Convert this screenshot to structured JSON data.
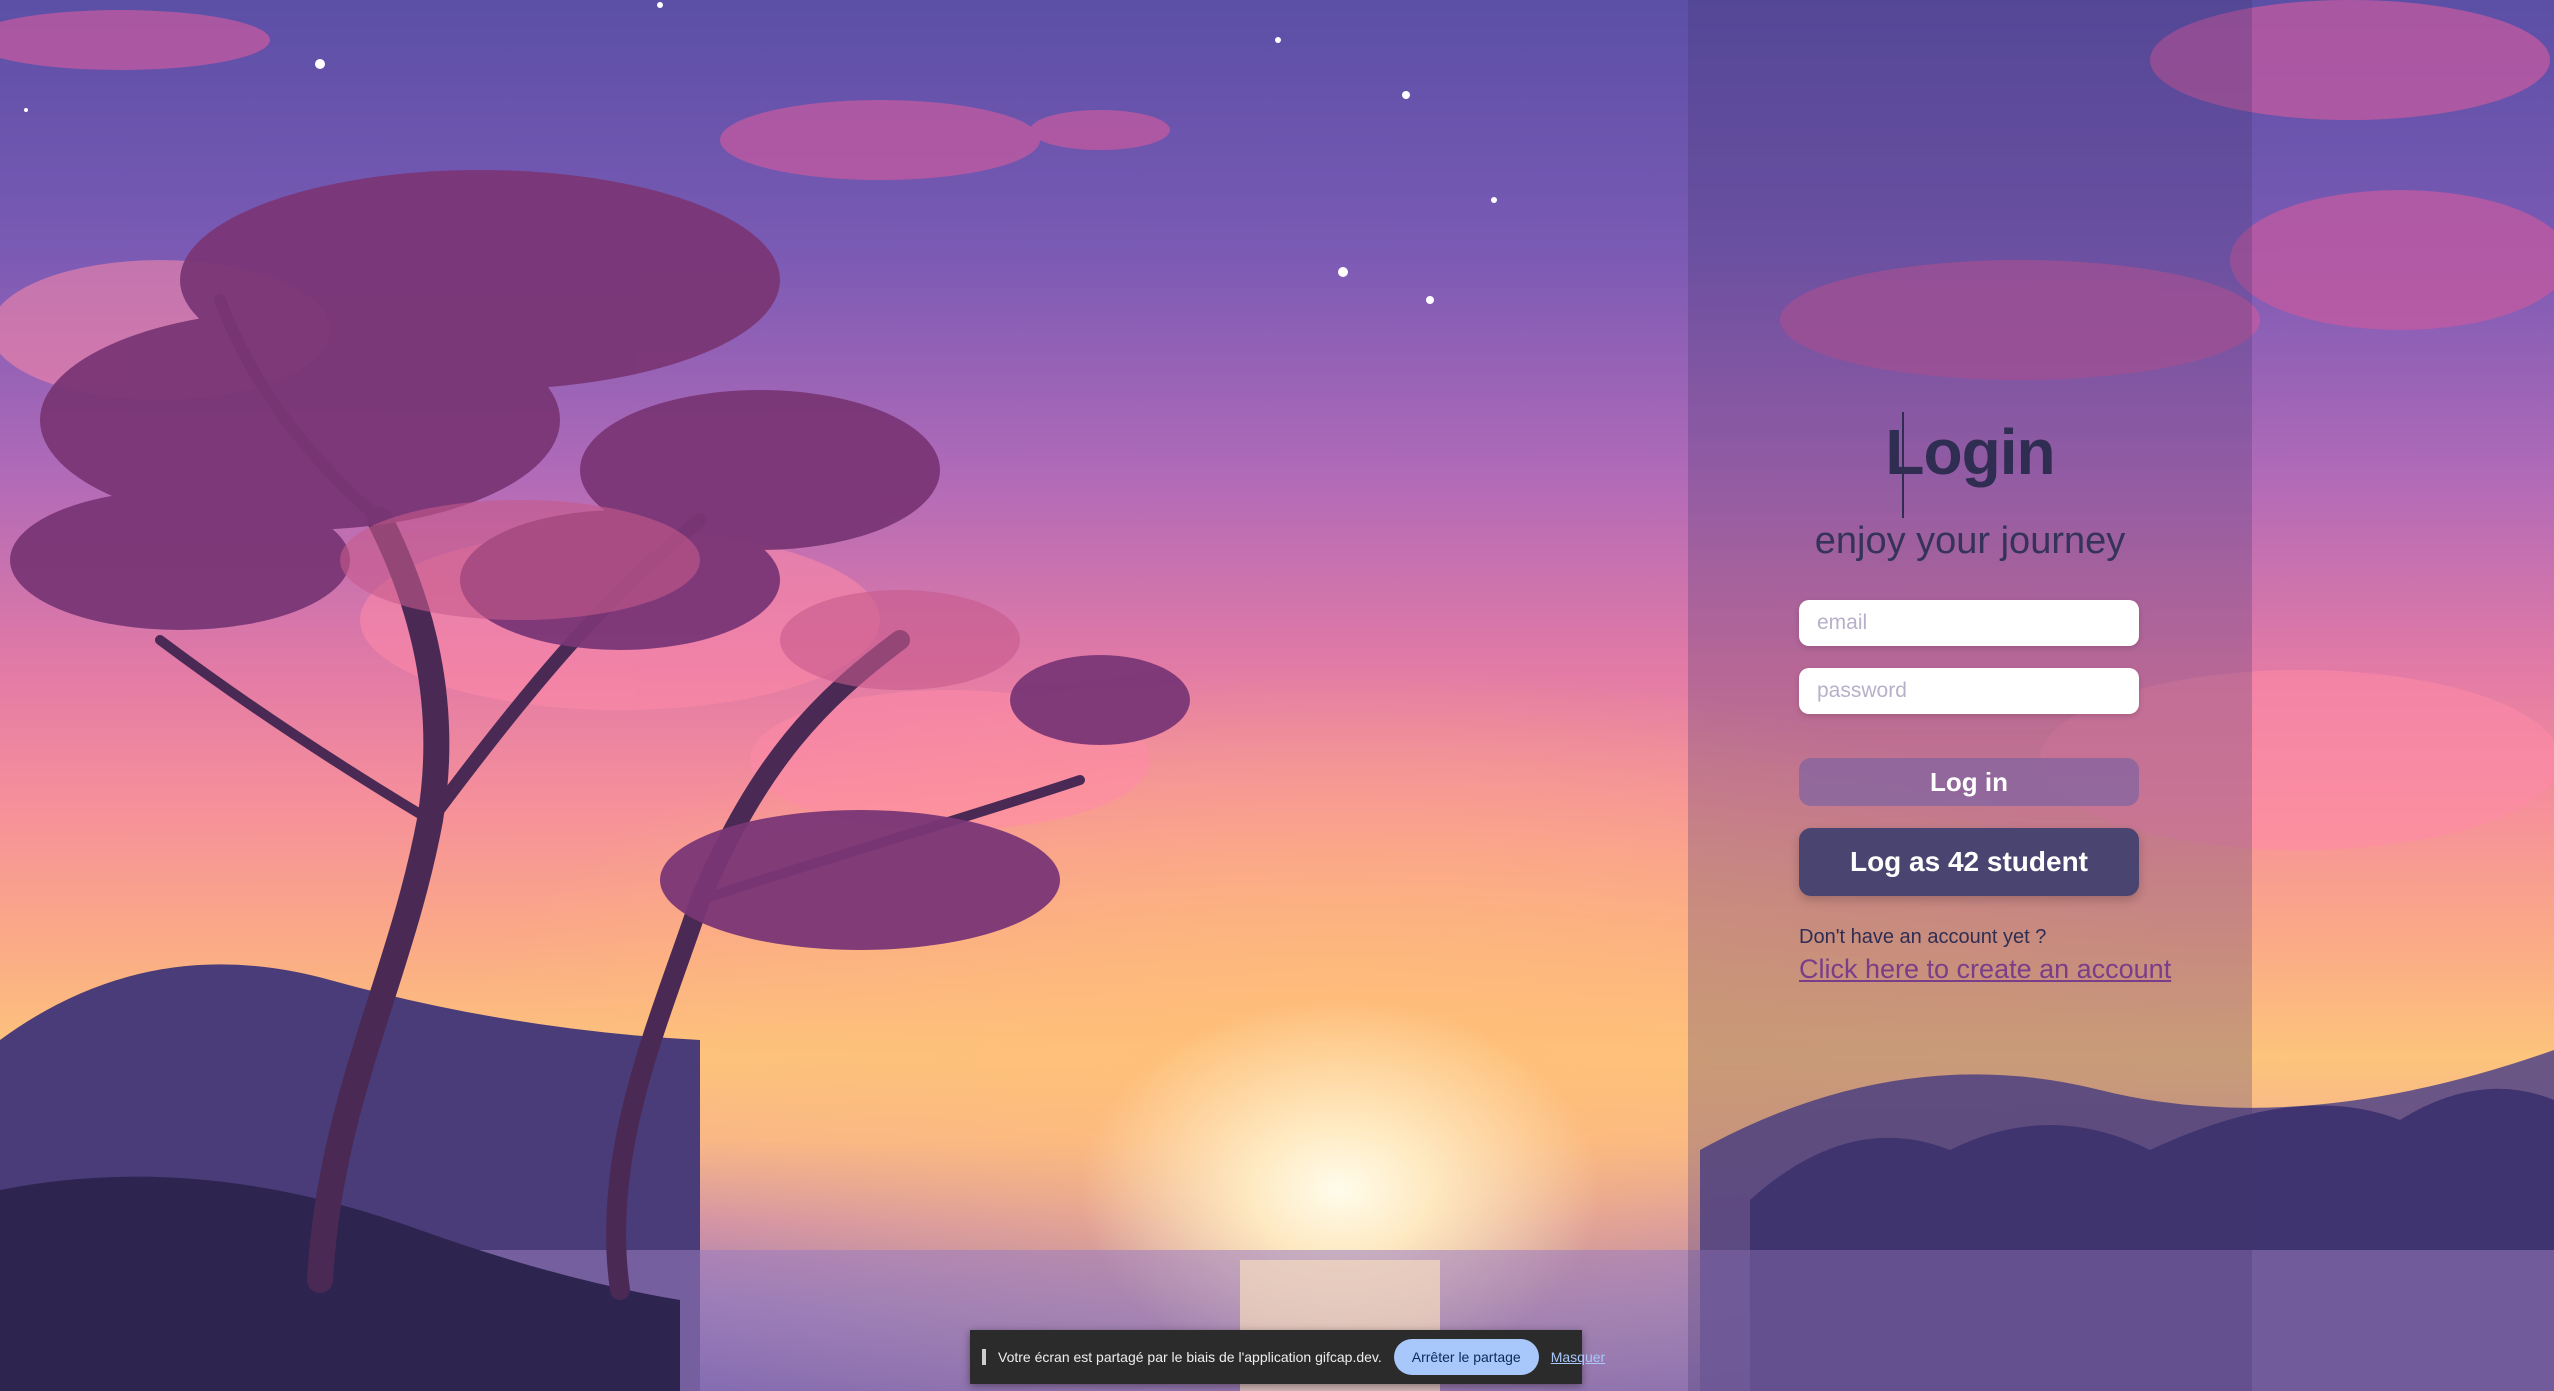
{
  "login": {
    "title": "Login",
    "subtitle": "enjoy your journey",
    "email_placeholder": "email",
    "password_placeholder": "password",
    "login_button": "Log in",
    "student_button": "Log as 42 student",
    "no_account_text": "Don't have an account yet ?",
    "create_account_link": "Click here to create an account"
  },
  "share_bar": {
    "message": "Votre écran est partagé par le biais de l'application gifcap.dev.",
    "stop_button": "Arrêter le partage",
    "hide_link": "Masquer"
  }
}
